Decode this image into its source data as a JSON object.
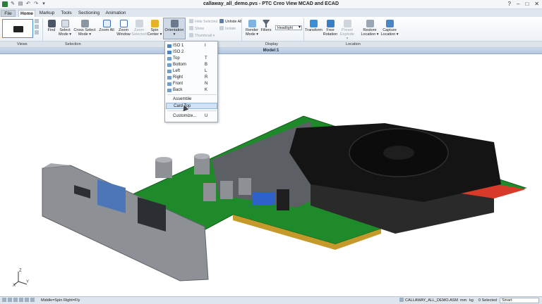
{
  "window": {
    "title": "callaway_all_demo.pvs - PTC Creo View MCAD and ECAD"
  },
  "tabs": [
    {
      "label": "File"
    },
    {
      "label": "Home"
    },
    {
      "label": "Markup"
    },
    {
      "label": "Tools"
    },
    {
      "label": "Sectioning"
    },
    {
      "label": "Animation"
    }
  ],
  "ribbon": {
    "find": "Find",
    "select_mode": "Select Mode",
    "cross_select_mode": "Cross Select Mode",
    "zoom_all": "Zoom All",
    "zoom_window": "Zoom Window",
    "zoom_selected": "Zoom Selected",
    "spin_center": "Spin Center",
    "orientation": "Orientation",
    "hide_selected": "Hide Selected",
    "show": "Show",
    "thumbnail": "Thumbnail",
    "unhide_all": "Unhide All",
    "isolate": "Isolate",
    "render_mode": "Render Mode",
    "filters": "Filters",
    "headlight": "Headlight",
    "transform": "Transform",
    "free_rotation": "Free Rotation",
    "preset_explode": "Preset Explode",
    "restore_location": "Restore Location",
    "capture_location": "Capture Location",
    "groups": {
      "views": "Views",
      "selection": "Selection",
      "display": "Display",
      "location": "Location"
    }
  },
  "model_header": "Model:1",
  "orientation_menu": {
    "items": [
      {
        "label": "ISO 1",
        "key": "I"
      },
      {
        "label": "ISO 2",
        "key": ""
      },
      {
        "label": "Top",
        "key": "T"
      },
      {
        "label": "Bottom",
        "key": "B"
      },
      {
        "label": "Left",
        "key": "L"
      },
      {
        "label": "Right",
        "key": "R"
      },
      {
        "label": "Front",
        "key": "N"
      },
      {
        "label": "Back",
        "key": "K"
      },
      {
        "label": "Assemble",
        "key": ""
      },
      {
        "label": "Card Top",
        "key": ""
      },
      {
        "label": "Customize...",
        "key": "U"
      }
    ],
    "highlighted": "Card Top"
  },
  "triad": {
    "x": "X",
    "y": "Y",
    "z": "Z"
  },
  "statusbar": {
    "mouse_hint": "Middle=Spin  Right=Fly",
    "assembly": "CALLAWAY_ALL_DEMO.ASM",
    "units_length": "mm",
    "units_mass": "kg",
    "selected": "0 Selected",
    "mode": "Smart"
  },
  "colors": {
    "pcb_green": "#1f8a2a",
    "heatsink_black": "#141414",
    "accent_red": "#d83a2a",
    "bracket_grey": "#8d9196",
    "menu_highlight": "#cfe2f6"
  }
}
